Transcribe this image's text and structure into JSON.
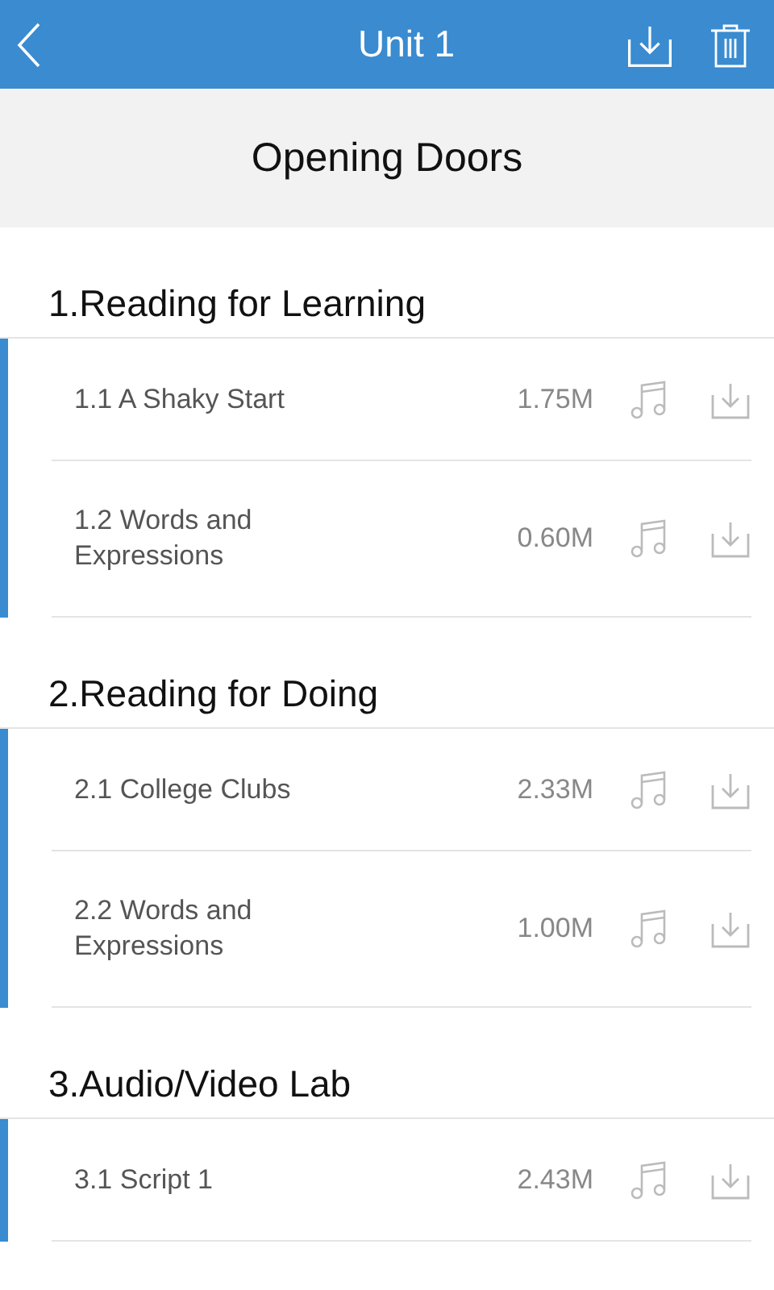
{
  "header": {
    "title": "Unit 1"
  },
  "subheader": {
    "title": "Opening Doors"
  },
  "sections": [
    {
      "title": "1.Reading for Learning",
      "items": [
        {
          "title": "1.1 A Shaky Start",
          "size": "1.75M"
        },
        {
          "title": "1.2 Words and Expressions",
          "size": "0.60M"
        }
      ]
    },
    {
      "title": "2.Reading for Doing",
      "items": [
        {
          "title": "2.1 College Clubs",
          "size": "2.33M"
        },
        {
          "title": "2.2 Words and Expressions",
          "size": "1.00M"
        }
      ]
    },
    {
      "title": "3.Audio/Video Lab",
      "items": [
        {
          "title": "3.1 Script 1",
          "size": "2.43M"
        }
      ]
    }
  ]
}
